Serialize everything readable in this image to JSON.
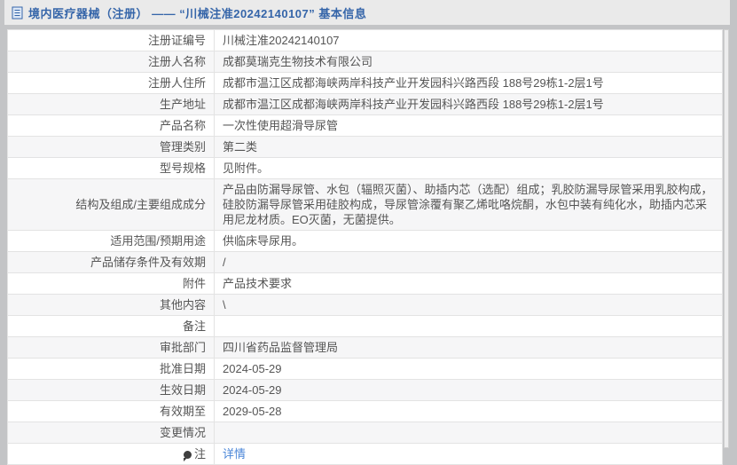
{
  "header": {
    "icon": "document-icon",
    "title": "境内医疗器械（注册） —— “川械注准20242140107” 基本信息"
  },
  "colors": {
    "accent_blue": "#3565a9",
    "link_blue": "#4a86d8",
    "page_background": "#c3c4c6",
    "header_background": "#eaeaea",
    "row_alt_background": "#f6f6f7",
    "text": "#555555"
  },
  "table": {
    "rows": [
      {
        "label": "注册证编号",
        "value": "川械注准20242140107"
      },
      {
        "label": "注册人名称",
        "value": "成都莫瑞克生物技术有限公司"
      },
      {
        "label": "注册人住所",
        "value": "成都市温江区成都海峡两岸科技产业开发园科兴路西段 188号29栋1-2层1号"
      },
      {
        "label": "生产地址",
        "value": "成都市温江区成都海峡两岸科技产业开发园科兴路西段 188号29栋1-2层1号"
      },
      {
        "label": "产品名称",
        "value": "一次性使用超滑导尿管"
      },
      {
        "label": "管理类别",
        "value": "第二类"
      },
      {
        "label": "型号规格",
        "value": "见附件。"
      },
      {
        "label": "结构及组成/主要组成成分",
        "value": "产品由防漏导尿管、水包（辐照灭菌）、助插内芯（选配）组成；乳胶防漏导尿管采用乳胶构成，硅胶防漏导尿管采用硅胶构成，导尿管涂覆有聚乙烯吡咯烷酮，水包中装有纯化水，助插内芯采用尼龙材质。EO灭菌，无菌提供。"
      },
      {
        "label": "适用范围/预期用途",
        "value": "供临床导尿用。"
      },
      {
        "label": "产品储存条件及有效期",
        "value": "/"
      },
      {
        "label": "附件",
        "value": "产品技术要求"
      },
      {
        "label": "其他内容",
        "value": "\\"
      },
      {
        "label": "备注",
        "value": ""
      },
      {
        "label": "审批部门",
        "value": "四川省药品监督管理局"
      },
      {
        "label": "批准日期",
        "value": "2024-05-29"
      },
      {
        "label": "生效日期",
        "value": "2024-05-29"
      },
      {
        "label": "有效期至",
        "value": "2029-05-28"
      },
      {
        "label": "变更情况",
        "value": ""
      },
      {
        "label": "注",
        "label_icon": "note-icon",
        "value": "详情",
        "value_is_link": true
      }
    ]
  }
}
